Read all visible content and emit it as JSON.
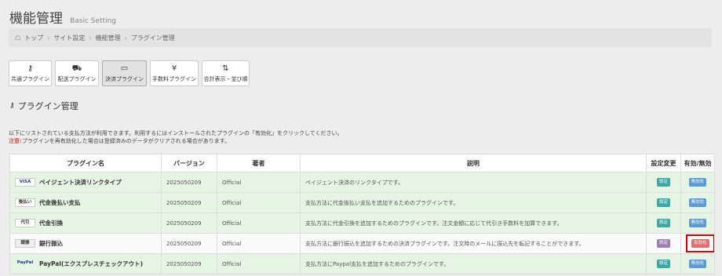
{
  "header": {
    "title": "機能管理",
    "subtitle": "Basic Setting"
  },
  "breadcrumb": [
    "トップ",
    "サイト設定",
    "機能管理",
    "プラグイン管理"
  ],
  "toolbar": [
    {
      "label": "共通プラグイン",
      "icon": "key-icon"
    },
    {
      "label": "配送プラグイン",
      "icon": "truck-icon"
    },
    {
      "label": "決済プラグイン",
      "icon": "credit-card-icon",
      "active": true
    },
    {
      "label": "手数料プラグイン",
      "icon": "yen-icon"
    },
    {
      "label": "合計表示・並び順",
      "icon": "sort-icon"
    }
  ],
  "section_title": "プラグイン管理",
  "description": {
    "line1": "以下にリストされている支払方法が利用できます。利用するにはインストールされたプラグインの「有効化」をクリックしてください。",
    "warn_label": "注意:",
    "warn_text": "プラグインを再有効化した場合は登録済みのデータがクリアされる場合があります。"
  },
  "table": {
    "headers": [
      "プラグイン名",
      "バージョン",
      "著者",
      "説明",
      "設定変更",
      "有効/無効"
    ],
    "rows": [
      {
        "logo": "VISA",
        "name": "ペイジェント決済リンクタイプ",
        "version": "2025050209",
        "author": "Official",
        "desc": "ペイジェント決済のリンクタイプです。",
        "setting": "設定",
        "toggle": "無効化"
      },
      {
        "logo": "後払い",
        "name": "代金後払い支払",
        "version": "2025050209",
        "author": "Official",
        "desc": "支払方法に代金後払い支払を追加するためのプラグインです。",
        "setting": "設定",
        "toggle": "無効化"
      },
      {
        "logo": "代引",
        "name": "代金引換",
        "version": "2025050209",
        "author": "Official",
        "desc": "支払方法に代金引換を追加するためのプラグインです。注文金額に応じて代引き手数料を加算できます。",
        "setting": "設定",
        "toggle": "無効化"
      },
      {
        "logo": "銀振",
        "name": "銀行振込",
        "version": "2025050209",
        "author": "Official",
        "desc": "支払方法に銀行振込を追加するための決済プラグインです。注文時のメールに振込先を転記することができます。",
        "setting": "設定",
        "toggle": "有効化"
      },
      {
        "logo": "PayPal",
        "name": "PayPal(エクスプレスチェックアウト)",
        "version": "2025050209",
        "author": "Official",
        "desc": "支払方法にPaypal支払を追加するためのプラグインです。",
        "setting": "設定",
        "toggle": "無効化"
      }
    ]
  },
  "colors": {
    "row_enabled": "#e6f4e4",
    "setting_badge": "#3aa8a5",
    "disable_badge": "#5b9bd5",
    "enable_badge": "#e36e6e",
    "highlight": "#e00000"
  }
}
